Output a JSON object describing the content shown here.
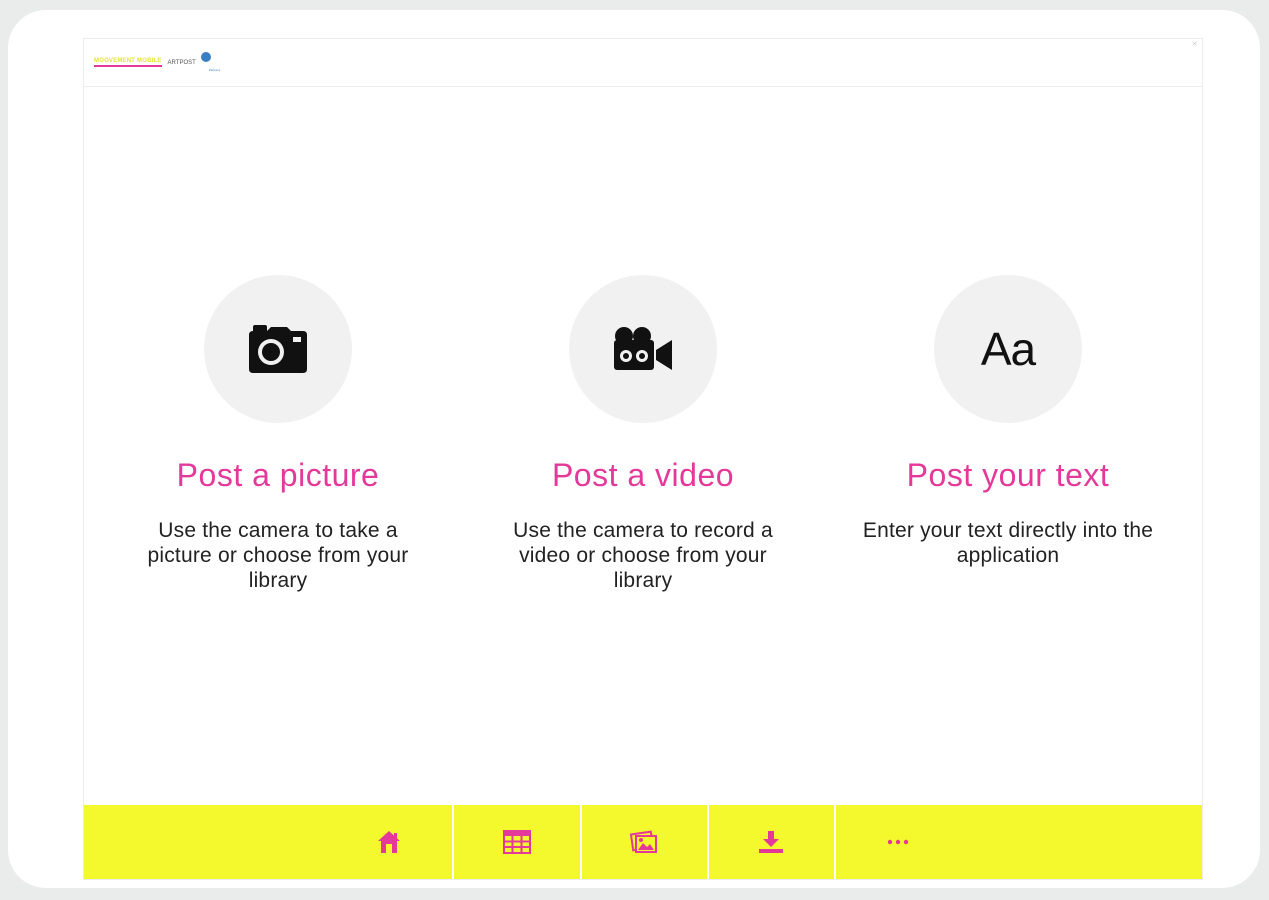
{
  "header": {
    "logo_main": "MOOVEMENT MOBILE",
    "logo_partner": "ARTPOST",
    "logo_sub": "Partners"
  },
  "options": [
    {
      "title": "Post a picture",
      "description": "Use the camera to take a picture or choose from your library",
      "icon": "camera-icon"
    },
    {
      "title": "Post a video",
      "description": "Use the camera to record a video or choose from your library",
      "icon": "video-camera-icon"
    },
    {
      "title": "Post your text",
      "description": "Enter your text directly into the application",
      "icon_text": "Aa"
    }
  ],
  "tabbar": {
    "items": [
      {
        "icon": "home-icon"
      },
      {
        "icon": "grid-icon"
      },
      {
        "icon": "gallery-icon"
      },
      {
        "icon": "download-icon"
      },
      {
        "icon": "more-icon"
      }
    ]
  },
  "colors": {
    "accent": "#e4399a",
    "tabbar": "#f3f92c",
    "circle": "#f1f1f1"
  }
}
